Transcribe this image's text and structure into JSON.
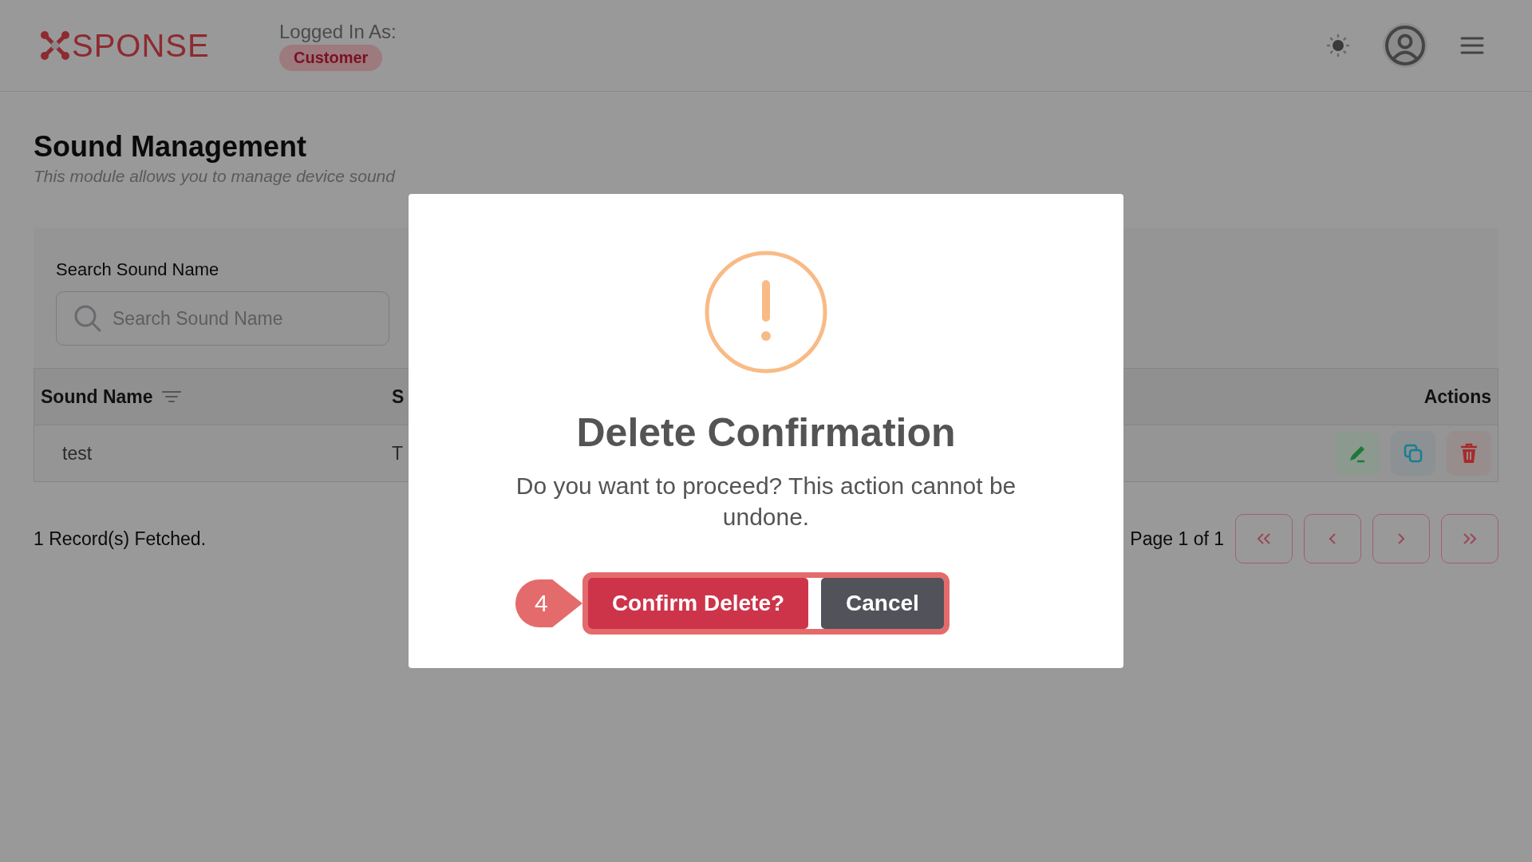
{
  "header": {
    "logo": "SPONSE",
    "logged_in_label": "Logged In As:",
    "role_badge": "Customer"
  },
  "page": {
    "title": "Sound Management",
    "subtitle": "This module allows you to manage device sound"
  },
  "search": {
    "label": "Search Sound Name",
    "placeholder": "Search Sound Name"
  },
  "table": {
    "columns": [
      {
        "label": "Sound Name"
      },
      {
        "label": "S"
      },
      {
        "label": "Actions"
      }
    ],
    "rows": [
      {
        "cells": [
          "test",
          "T"
        ]
      }
    ]
  },
  "footer": {
    "record_count": "1 Record(s) Fetched.",
    "page_info": "Page 1 of 1"
  },
  "dialog": {
    "title": "Delete Confirmation",
    "message": "Do you want to proceed? This action cannot be undone.",
    "tour_step": "4",
    "buttons": [
      {
        "label": "Confirm Delete?",
        "kind": "danger"
      },
      {
        "label": "Cancel",
        "kind": "secondary"
      }
    ]
  }
}
